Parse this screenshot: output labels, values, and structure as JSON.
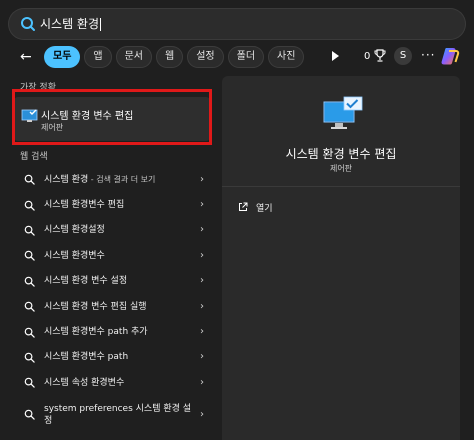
{
  "search": {
    "value": "시스템 환경"
  },
  "filters": {
    "tabs": [
      "모두",
      "앱",
      "문서",
      "웹",
      "설정",
      "폴더",
      "사진"
    ],
    "points": "0",
    "avatar_initial": "S",
    "more": "···"
  },
  "best_match": {
    "section_label": "가장 정확",
    "title": "시스템 환경 변수 편집",
    "subtitle": "제어판"
  },
  "web": {
    "section_label": "웹 검색",
    "results": [
      {
        "text": "시스템 환경",
        "suffix": " - 검색 결과 더 보기"
      },
      {
        "text": "시스템 환경변수 편집",
        "suffix": ""
      },
      {
        "text": "시스템 환경설정",
        "suffix": ""
      },
      {
        "text": "시스템 환경변수",
        "suffix": ""
      },
      {
        "text": "시스템 환경 변수 설정",
        "suffix": ""
      },
      {
        "text": "시스템 환경 변수 편집 실행",
        "suffix": ""
      },
      {
        "text": "시스템 환경변수 path 추가",
        "suffix": ""
      },
      {
        "text": "시스템 환경변수 path",
        "suffix": ""
      },
      {
        "text": "시스템 속성 환경변수",
        "suffix": ""
      },
      {
        "text": "system preferences 시스템 환경 설정",
        "suffix": ""
      }
    ]
  },
  "detail": {
    "title": "시스템 환경 변수 편집",
    "subtitle": "제어판",
    "actions": [
      {
        "label": "열기"
      }
    ]
  },
  "colors": {
    "accent": "#4cc2ff",
    "highlight_box": "#e01919",
    "background": "#1f1f1f",
    "pane": "#2a2a2a"
  }
}
